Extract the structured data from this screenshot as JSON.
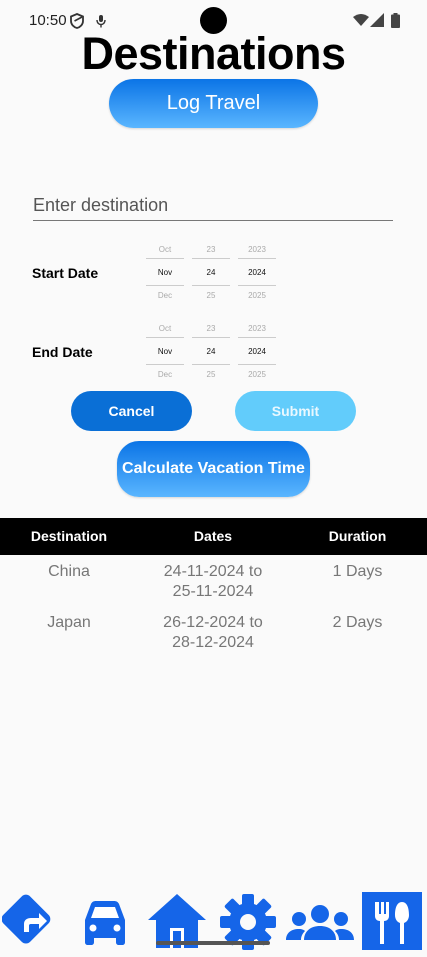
{
  "status_bar": {
    "time": "10:50",
    "icons": [
      "shield-icon",
      "microphone-icon",
      "wifi-icon",
      "signal-icon",
      "battery-icon"
    ]
  },
  "page": {
    "title": "Destinations",
    "log_button": "Log Travel"
  },
  "form": {
    "destination_placeholder": "Enter destination",
    "destination_value": "",
    "start_date": {
      "label": "Start Date",
      "month": {
        "prev": "Oct",
        "selected": "Nov",
        "next": "Dec"
      },
      "day": {
        "prev": "23",
        "selected": "24",
        "next": "25"
      },
      "year": {
        "prev": "2023",
        "selected": "2024",
        "next": "2025"
      }
    },
    "end_date": {
      "label": "End Date",
      "month": {
        "prev": "Oct",
        "selected": "Nov",
        "next": "Dec"
      },
      "day": {
        "prev": "23",
        "selected": "24",
        "next": "25"
      },
      "year": {
        "prev": "2023",
        "selected": "2024",
        "next": "2025"
      }
    },
    "cancel_label": "Cancel",
    "submit_label": "Submit",
    "calculate_label": "Calculate Vacation Time"
  },
  "table": {
    "headers": [
      "Destination",
      "Dates",
      "Duration"
    ],
    "rows": [
      {
        "destination": "China",
        "dates_from": "24-11-2024 to",
        "dates_to": "25-11-2024",
        "duration": "1 Days"
      },
      {
        "destination": "Japan",
        "dates_from": "26-12-2024 to",
        "dates_to": "28-12-2024",
        "duration": "2 Days"
      }
    ]
  },
  "bottom_nav": {
    "items": [
      "directions-icon",
      "car-icon",
      "home-icon",
      "settings-icon",
      "group-icon",
      "restaurant-icon"
    ],
    "accent_color": "#1565e8",
    "active_item": "restaurant-icon"
  }
}
